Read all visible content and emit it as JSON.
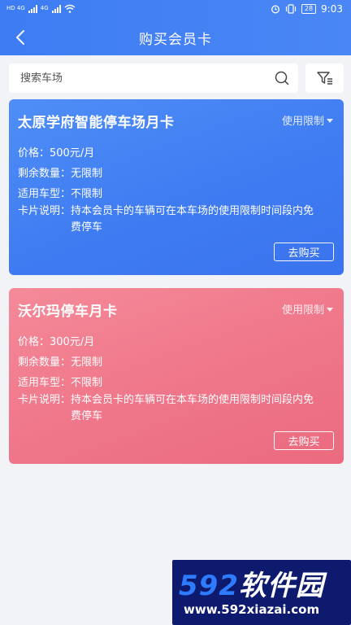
{
  "status_bar": {
    "network_1": "HD 4G",
    "network_2": "4G",
    "battery": "28",
    "time": "9:03"
  },
  "header": {
    "title": "购买会员卡"
  },
  "search": {
    "placeholder": "搜索车场"
  },
  "cards": [
    {
      "title": "太原学府智能停车场月卡",
      "limit_label": "使用限制",
      "price_label": "价格：",
      "price": "500元/月",
      "remaining_label": "剩余数量：",
      "remaining": "无限制",
      "vehicle_label": "适用车型：",
      "vehicle": "不限制",
      "desc_label": "卡片说明：",
      "desc": "持本会员卡的车辆可在本车场的使用限制时间段内免费停车",
      "buy_label": "去购买",
      "color": "#3f7cf2"
    },
    {
      "title": "沃尔玛停车月卡",
      "limit_label": "使用限制",
      "price_label": "价格：",
      "price": "300元/月",
      "remaining_label": "剩余数量：",
      "remaining": "无限制",
      "vehicle_label": "适用车型：",
      "vehicle": "不限制",
      "desc_label": "卡片说明：",
      "desc": "持本会员卡的车辆可在本车场的使用限制时间段内免费停车",
      "buy_label": "去购买",
      "color": "#ef7689"
    }
  ],
  "watermark": {
    "logo_number": "592",
    "logo_text": "软件园",
    "url": "www.592xiazai.com"
  },
  "colors": {
    "header": "#3d7cf3",
    "background": "#f2f3f7"
  }
}
